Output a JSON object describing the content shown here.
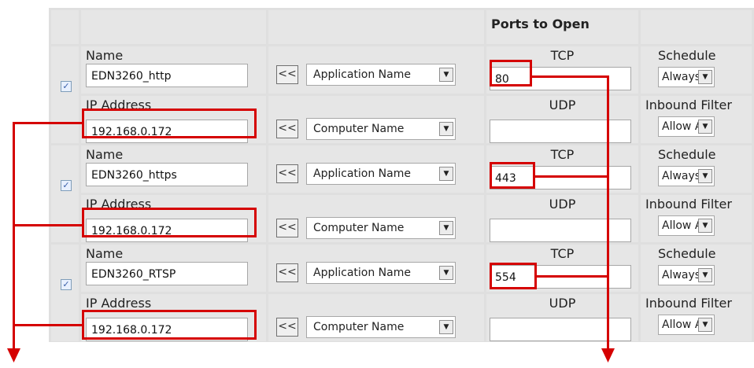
{
  "header": {
    "ports_to_open": "Ports to Open"
  },
  "labels": {
    "name": "Name",
    "ip_address": "IP Address",
    "tcp": "TCP",
    "udp": "UDP",
    "schedule": "Schedule",
    "inbound_filter": "Inbound Filter",
    "move_button": "<<"
  },
  "rules": [
    {
      "checked": true,
      "name": "EDN3260_http",
      "ip": "192.168.0.172",
      "tcp": "80",
      "udp": "",
      "application_name": "Application Name",
      "computer_name": "Computer Name",
      "schedule": "Always",
      "inbound_filter": "Allow All"
    },
    {
      "checked": true,
      "name": "EDN3260_https",
      "ip": "192.168.0.172",
      "tcp": "443",
      "udp": "",
      "application_name": "Application Name",
      "computer_name": "Computer Name",
      "schedule": "Always",
      "inbound_filter": "Allow All"
    },
    {
      "checked": true,
      "name": "EDN3260_RTSP",
      "ip": "192.168.0.172",
      "tcp": "554",
      "udp": "",
      "application_name": "Application Name",
      "computer_name": "Computer Name",
      "schedule": "Always",
      "inbound_filter": "Allow All"
    }
  ],
  "icons": {
    "checkbox": "checkmark-icon",
    "dropdown": "dropdown-arrow-icon"
  },
  "colors": {
    "highlight": "#d50000",
    "panel": "#e6e6e6"
  }
}
